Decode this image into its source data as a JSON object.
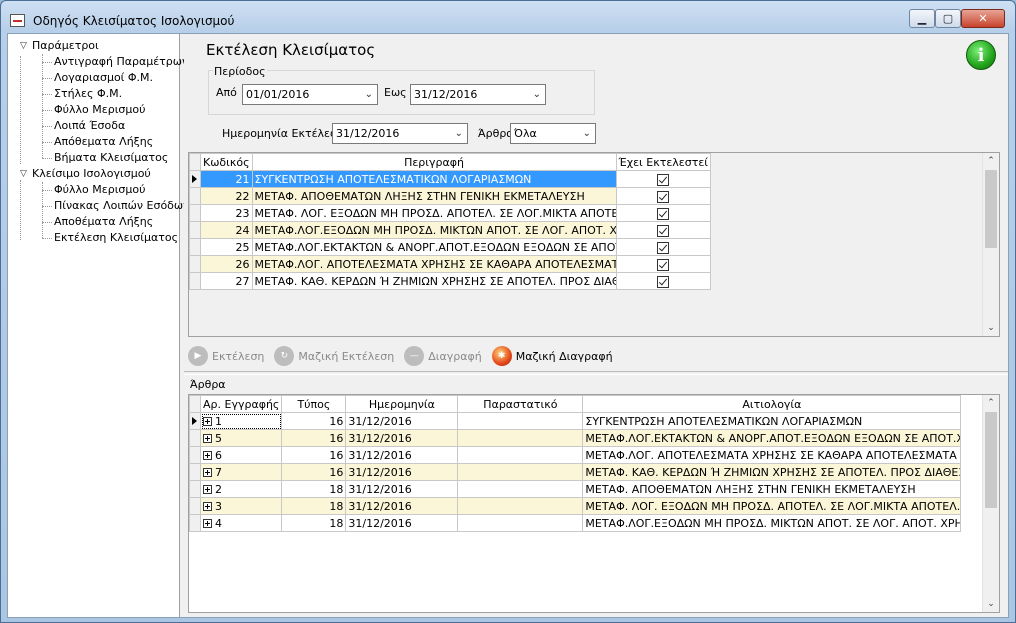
{
  "window": {
    "title": "Οδηγός Κλεισίματος Ισολογισμού",
    "min": "▁",
    "max": "▢",
    "close": "✕"
  },
  "tree": {
    "group1": {
      "label": "Παράμετροι",
      "items": [
        "Αντιγραφή Παραμέτρων",
        "Λογαριασμοί Φ.Μ.",
        "Στήλες Φ.Μ.",
        "Φύλλο Μερισμού",
        "Λοιπά Έσοδα",
        "Απόθεματα Λήξης",
        "Βήματα Κλεισίματος"
      ]
    },
    "group2": {
      "label": "Κλείσιμο Ισολογισμού",
      "items": [
        "Φύλλο Μερισμού",
        "Πίνακας Λοιπών Εσόδων",
        "Αποθέματα Λήξης",
        "Εκτέλεση Κλεισίματος"
      ]
    }
  },
  "main": {
    "heading": "Εκτέλεση Κλεισίματος",
    "period_legend": "Περίοδος",
    "from_label": "Από",
    "from_value": "01/01/2016",
    "to_label": "Εως",
    "to_value": "31/12/2016",
    "exec_date_label": "Ημερομηνία Εκτέλεσης",
    "exec_date_value": "31/12/2016",
    "articles_label": "Άρθρα",
    "articles_value": "Όλα"
  },
  "steps_grid": {
    "headers": {
      "code": "Κωδικός",
      "desc": "Περιγραφή",
      "done": "Έχει Εκτελεστεί"
    },
    "rows": [
      {
        "code": "21",
        "desc": "ΣΥΓΚΕΝΤΡΩΣΗ ΑΠΟΤΕΛΕΣΜΑΤΙΚΩΝ ΛΟΓΑΡΙΑΣΜΩΝ",
        "done": true
      },
      {
        "code": "22",
        "desc": "ΜΕΤΑΦ. ΑΠΟΘΕΜΑΤΩΝ ΛΗΞΗΣ ΣΤΗΝ ΓΕΝΙΚΗ ΕΚΜΕΤΑΛΕΥΣΗ",
        "done": true
      },
      {
        "code": "23",
        "desc": "ΜΕΤΑΦ. ΛΟΓ. ΕΞΟΔΩΝ ΜΗ ΠΡΟΣΔ. ΑΠΟΤΕΛ. ΣΕ ΛΟΓ.ΜΙΚΤΑ ΑΠΟΤΕΛ.",
        "done": true
      },
      {
        "code": "24",
        "desc": "ΜΕΤΑΦ.ΛΟΓ.ΕΞΟΔΩΝ ΜΗ ΠΡΟΣΔ. ΜΙΚΤΩΝ ΑΠΟΤ. ΣΕ ΛΟΓ. ΑΠΟΤ. ΧΡΗΣΗΣ",
        "done": true
      },
      {
        "code": "25",
        "desc": "ΜΕΤΑΦ.ΛΟΓ.ΕΚΤΑΚΤΩΝ & ΑΝΟΡΓ.ΑΠΟΤ.ΕΞΟΔΩΝ ΕΞΟΔΩΝ ΣΕ ΑΠΟΤ.ΧΡΗΣΗΣ",
        "done": true
      },
      {
        "code": "26",
        "desc": "ΜΕΤΑΦ.ΛΟΓ. ΑΠΟΤΕΛΕΣΜΑΤΑ ΧΡΗΣΗΣ ΣΕ ΚΑΘΑΡΑ ΑΠΟΤΕΛΕΣΜΑΤΑ ΧΡΗΣΗΣ",
        "done": true
      },
      {
        "code": "27",
        "desc": "ΜΕΤΑΦ. ΚΑΘ. ΚΕΡΔΩΝ Ή ΖΗΜΙΩΝ ΧΡΗΣΗΣ ΣΕ ΑΠΟΤΕΛ. ΠΡΟΣ ΔΙΑΘΕΣΗ",
        "done": true
      }
    ]
  },
  "toolbar": {
    "execute": "Εκτέλεση",
    "bulk_execute": "Μαζική Εκτέλεση",
    "delete": "Διαγραφή",
    "bulk_delete": "Μαζική Διαγραφή"
  },
  "articles": {
    "caption": "Άρθρα",
    "headers": {
      "entry": "Αρ. Εγγραφής",
      "type": "Τύπος",
      "date": "Ημερομηνία",
      "doc": "Παραστατικό",
      "reason": "Αιτιολογία"
    },
    "rows": [
      {
        "entry": "1",
        "type": "16",
        "date": "31/12/2016",
        "doc": "",
        "reason": "ΣΥΓΚΕΝΤΡΩΣΗ ΑΠΟΤΕΛΕΣΜΑΤΙΚΩΝ ΛΟΓΑΡΙΑΣΜΩΝ"
      },
      {
        "entry": "5",
        "type": "16",
        "date": "31/12/2016",
        "doc": "",
        "reason": "ΜΕΤΑΦ.ΛΟΓ.ΕΚΤΑΚΤΩΝ & ΑΝΟΡΓ.ΑΠΟΤ.ΕΞΟΔΩΝ ΕΞΟΔΩΝ ΣΕ ΑΠΟΤ.ΧΡΗΣΗΣ"
      },
      {
        "entry": "6",
        "type": "16",
        "date": "31/12/2016",
        "doc": "",
        "reason": "ΜΕΤΑΦ.ΛΟΓ. ΑΠΟΤΕΛΕΣΜΑΤΑ ΧΡΗΣΗΣ ΣΕ ΚΑΘΑΡΑ ΑΠΟΤΕΛΕΣΜΑΤΑ ΧΡΗΣΗΣ"
      },
      {
        "entry": "7",
        "type": "16",
        "date": "31/12/2016",
        "doc": "",
        "reason": "ΜΕΤΑΦ. ΚΑΘ. ΚΕΡΔΩΝ Ή ΖΗΜΙΩΝ ΧΡΗΣΗΣ ΣΕ ΑΠΟΤΕΛ. ΠΡΟΣ ΔΙΑΘΕΣΗ"
      },
      {
        "entry": "2",
        "type": "18",
        "date": "31/12/2016",
        "doc": "",
        "reason": "ΜΕΤΑΦ. ΑΠΟΘΕΜΑΤΩΝ ΛΗΞΗΣ ΣΤΗΝ ΓΕΝΙΚΗ ΕΚΜΕΤΑΛΕΥΣΗ"
      },
      {
        "entry": "3",
        "type": "18",
        "date": "31/12/2016",
        "doc": "",
        "reason": "ΜΕΤΑΦ. ΛΟΓ. ΕΞΟΔΩΝ ΜΗ ΠΡΟΣΔ. ΑΠΟΤΕΛ. ΣΕ ΛΟΓ.ΜΙΚΤΑ ΑΠΟΤΕΛ."
      },
      {
        "entry": "4",
        "type": "18",
        "date": "31/12/2016",
        "doc": "",
        "reason": "ΜΕΤΑΦ.ΛΟΓ.ΕΞΟΔΩΝ ΜΗ ΠΡΟΣΔ. ΜΙΚΤΩΝ ΑΠΟΤ. ΣΕ ΛΟΓ. ΑΠΟΤ. ΧΡΗΣΗΣ"
      }
    ]
  },
  "colors": {
    "selection": "#3399ff",
    "alt_row": "#fbf6d8",
    "info": "#21a41b"
  }
}
